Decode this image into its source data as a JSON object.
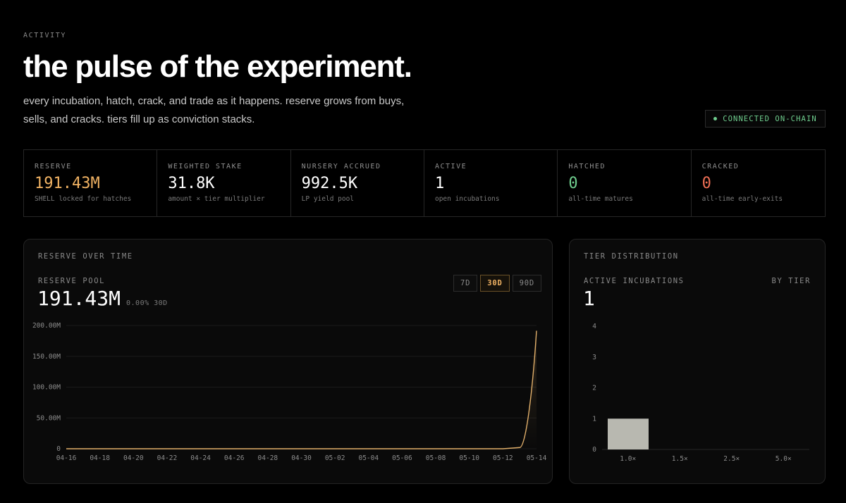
{
  "hero": {
    "eyebrow": "ACTIVITY",
    "title": "the pulse of the experiment.",
    "subtitle": "every incubation, hatch, crack, and trade as it happens. reserve grows from buys, sells, and cracks. tiers fill up as conviction stacks.",
    "status": "CONNECTED ON-CHAIN"
  },
  "stats": [
    {
      "label": "RESERVE",
      "value": "191.43M",
      "sub": "SHELL locked for hatches",
      "tone": "gold"
    },
    {
      "label": "WEIGHTED STAKE",
      "value": "31.8K",
      "sub": "amount × tier multiplier",
      "tone": "white"
    },
    {
      "label": "NURSERY ACCRUED",
      "value": "992.5K",
      "sub": "LP yield pool",
      "tone": "white"
    },
    {
      "label": "ACTIVE",
      "value": "1",
      "sub": "open incubations",
      "tone": "white"
    },
    {
      "label": "HATCHED",
      "value": "0",
      "sub": "all-time matures",
      "tone": "green"
    },
    {
      "label": "CRACKED",
      "value": "0",
      "sub": "all-time early-exits",
      "tone": "red"
    }
  ],
  "reserve_panel": {
    "title": "RESERVE OVER TIME",
    "kpi_label": "RESERVE POOL",
    "kpi_value": "191.43M",
    "kpi_delta": "0.00% 30D",
    "ranges": [
      "7D",
      "30D",
      "90D"
    ],
    "active_range": "30D"
  },
  "tier_panel": {
    "title": "TIER DISTRIBUTION",
    "kpi_label": "ACTIVE INCUBATIONS",
    "kpi_right": "BY TIER",
    "kpi_value": "1"
  },
  "colors": {
    "accent": "#f0b263",
    "positive": "#6fce8e",
    "negative": "#ee6f55",
    "bar": "#b8b8b0"
  },
  "chart_data": [
    {
      "type": "area",
      "title": "RESERVE OVER TIME",
      "xlabel": "",
      "ylabel": "",
      "x": [
        "04-16",
        "04-17",
        "04-18",
        "04-19",
        "04-20",
        "04-21",
        "04-22",
        "04-23",
        "04-24",
        "04-25",
        "04-26",
        "04-27",
        "04-28",
        "04-29",
        "04-30",
        "05-01",
        "05-02",
        "05-03",
        "05-04",
        "05-05",
        "05-06",
        "05-07",
        "05-08",
        "05-09",
        "05-10",
        "05-11",
        "05-12",
        "05-13",
        "05-14"
      ],
      "x_tick_labels": [
        "04-16",
        "04-18",
        "04-20",
        "04-22",
        "04-24",
        "04-26",
        "04-28",
        "04-30",
        "05-02",
        "05-04",
        "05-06",
        "05-08",
        "05-10",
        "05-12",
        "05-14"
      ],
      "values": [
        0,
        0,
        0,
        0,
        0,
        0,
        0,
        0,
        0,
        0,
        0,
        0,
        0,
        0,
        0,
        0,
        0,
        0,
        0,
        0,
        0,
        0,
        0,
        0,
        0,
        0,
        0,
        2,
        191.43
      ],
      "unit": "M",
      "y_ticks": [
        "0",
        "50.00M",
        "100.00M",
        "150.00M",
        "200.00M"
      ],
      "ylim": [
        0,
        200
      ],
      "grid": true,
      "color": "#e2b06b"
    },
    {
      "type": "bar",
      "title": "TIER DISTRIBUTION",
      "categories": [
        "1.0×",
        "1.5×",
        "2.5×",
        "5.0×"
      ],
      "values": [
        1,
        0,
        0,
        0
      ],
      "y_ticks": [
        "0",
        "1",
        "2",
        "3",
        "4"
      ],
      "ylim": [
        0,
        4
      ],
      "color": "#b8b8b0"
    }
  ]
}
